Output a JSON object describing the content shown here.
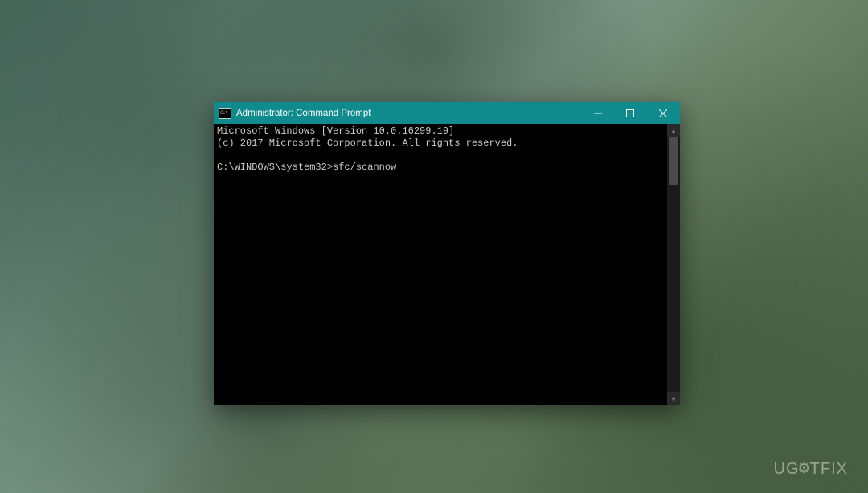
{
  "window": {
    "title": "Administrator: Command Prompt",
    "iconText": "C:\\"
  },
  "terminal": {
    "line1": "Microsoft Windows [Version 10.0.16299.19]",
    "line2": "(c) 2017 Microsoft Corporation. All rights reserved.",
    "blank": "",
    "prompt": "C:\\WINDOWS\\system32>",
    "command": "sfc/scannow"
  },
  "watermark": {
    "part1": "UG",
    "part2": "TFIX"
  }
}
